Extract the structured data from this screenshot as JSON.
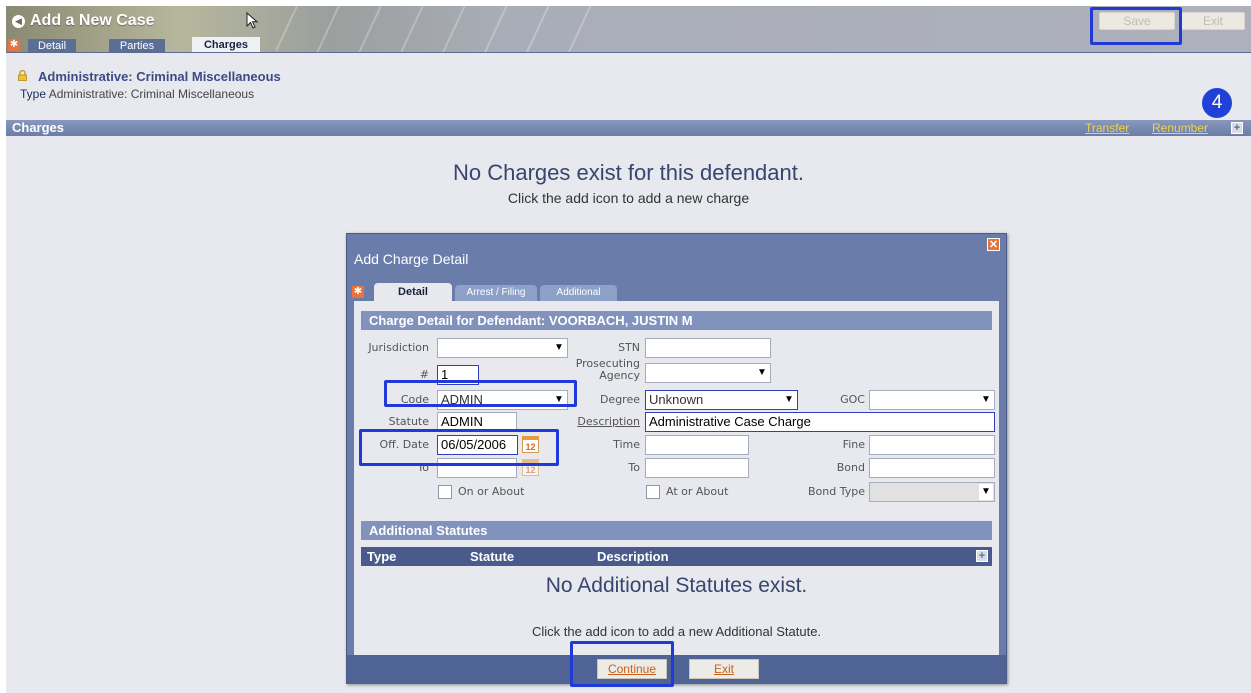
{
  "header": {
    "title": "Add a New Case",
    "tabs": [
      "Detail",
      "Parties",
      "Charges"
    ],
    "save_label": "Save",
    "exit_label": "Exit"
  },
  "step_number": "4",
  "case": {
    "title": "Administrative: Criminal Miscellaneous",
    "type_label": "Type",
    "type_value": "Administrative: Criminal Miscellaneous"
  },
  "charges": {
    "section_title": "Charges",
    "transfer_label": "Transfer",
    "renumber_label": "Renumber",
    "empty_title": "No Charges exist for this defendant.",
    "empty_hint": "Click the add icon to add a new charge"
  },
  "dialog": {
    "title": "Add Charge Detail",
    "tabs": [
      "Detail",
      "Arrest / Filing",
      "Additional"
    ],
    "section_title": "Charge Detail for Defendant: VOORBACH, JUSTIN M",
    "labels": {
      "jurisdiction": "Jurisdiction",
      "number": "#",
      "code": "Code",
      "statute": "Statute",
      "off_date": "Off. Date",
      "to": "To",
      "on_or_about": "On or About",
      "stn": "STN",
      "prosecuting_agency": "Prosecuting Agency",
      "degree": "Degree",
      "description": "Description",
      "time": "Time",
      "to2": "To",
      "at_or_about": "At or About",
      "goc": "GOC",
      "fine": "Fine",
      "bond": "Bond",
      "bond_type": "Bond Type"
    },
    "values": {
      "jurisdiction": "",
      "number": "1",
      "code": "ADMIN",
      "statute": "ADMIN",
      "off_date": "06/05/2006",
      "to": "",
      "stn": "",
      "prosecuting_agency": "",
      "degree": "Unknown",
      "description": "Administrative Case Charge",
      "time": "",
      "to2": "",
      "goc": "",
      "fine": "",
      "bond": "",
      "bond_type": ""
    },
    "additional_statutes": {
      "title": "Additional Statutes",
      "columns": [
        "Type",
        "Statute",
        "Description"
      ],
      "empty_title": "No Additional Statutes exist.",
      "empty_hint": "Click the add icon to add a new Additional Statute."
    },
    "continue_label": "Continue",
    "exit_label": "Exit"
  },
  "colors": {
    "highlight": "#1f3ad6",
    "header_bar": "#6b7ca6",
    "link": "#f0d34a",
    "accent_orange": "#e8743b"
  }
}
